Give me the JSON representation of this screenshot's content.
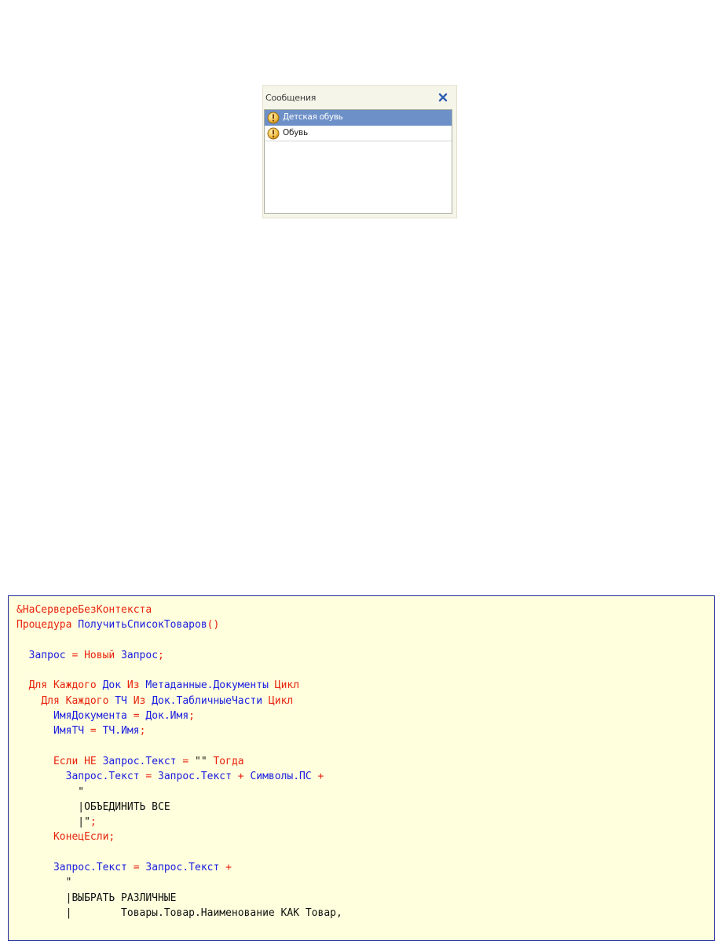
{
  "messages_panel": {
    "title": "Сообщения",
    "close_icon": "close-x-icon",
    "items": [
      {
        "text": "Детская обувь",
        "icon": "warning-icon",
        "selected": true
      },
      {
        "text": "Обувь",
        "icon": "warning-icon",
        "selected": false
      }
    ]
  },
  "code": {
    "lines": [
      [
        {
          "t": "&НаСервереБезКонтекста",
          "c": "kw"
        }
      ],
      [
        {
          "t": "Процедура ",
          "c": "kw"
        },
        {
          "t": "ПолучитьСписокТоваров",
          "c": "id"
        },
        {
          "t": "()",
          "c": "kw"
        }
      ],
      [],
      [
        {
          "t": "  ",
          "c": "pl"
        },
        {
          "t": "Запрос",
          "c": "id"
        },
        {
          "t": " = ",
          "c": "kw"
        },
        {
          "t": "Новый ",
          "c": "kw"
        },
        {
          "t": "Запрос",
          "c": "id"
        },
        {
          "t": ";",
          "c": "kw"
        }
      ],
      [],
      [
        {
          "t": "  ",
          "c": "pl"
        },
        {
          "t": "Для Каждого ",
          "c": "kw"
        },
        {
          "t": "Док",
          "c": "id"
        },
        {
          "t": " Из ",
          "c": "kw"
        },
        {
          "t": "Метаданные.Документы",
          "c": "id"
        },
        {
          "t": " Цикл",
          "c": "kw"
        }
      ],
      [
        {
          "t": "    ",
          "c": "pl"
        },
        {
          "t": "Для Каждого ",
          "c": "kw"
        },
        {
          "t": "ТЧ",
          "c": "id"
        },
        {
          "t": " Из ",
          "c": "kw"
        },
        {
          "t": "Док.ТабличныеЧасти",
          "c": "id"
        },
        {
          "t": " Цикл",
          "c": "kw"
        }
      ],
      [
        {
          "t": "      ",
          "c": "pl"
        },
        {
          "t": "ИмяДокумента",
          "c": "id"
        },
        {
          "t": " = ",
          "c": "kw"
        },
        {
          "t": "Док.Имя",
          "c": "id"
        },
        {
          "t": ";",
          "c": "kw"
        }
      ],
      [
        {
          "t": "      ",
          "c": "pl"
        },
        {
          "t": "ИмяТЧ",
          "c": "id"
        },
        {
          "t": " = ",
          "c": "kw"
        },
        {
          "t": "ТЧ.Имя",
          "c": "id"
        },
        {
          "t": ";",
          "c": "kw"
        }
      ],
      [],
      [
        {
          "t": "      ",
          "c": "pl"
        },
        {
          "t": "Если НЕ ",
          "c": "kw"
        },
        {
          "t": "Запрос.Текст",
          "c": "id"
        },
        {
          "t": " = ",
          "c": "kw"
        },
        {
          "t": "\"\"",
          "c": "str"
        },
        {
          "t": " Тогда",
          "c": "kw"
        }
      ],
      [
        {
          "t": "        ",
          "c": "pl"
        },
        {
          "t": "Запрос.Текст",
          "c": "id"
        },
        {
          "t": " = ",
          "c": "kw"
        },
        {
          "t": "Запрос.Текст",
          "c": "id"
        },
        {
          "t": " + ",
          "c": "kw"
        },
        {
          "t": "Символы.ПС",
          "c": "id"
        },
        {
          "t": " +",
          "c": "kw"
        }
      ],
      [
        {
          "t": "          \"",
          "c": "str"
        }
      ],
      [
        {
          "t": "          |ОБЪЕДИНИТЬ ВСЕ",
          "c": "str"
        }
      ],
      [
        {
          "t": "          |\"",
          "c": "str"
        },
        {
          "t": ";",
          "c": "kw"
        }
      ],
      [
        {
          "t": "      ",
          "c": "pl"
        },
        {
          "t": "КонецЕсли;",
          "c": "kw"
        }
      ],
      [],
      [
        {
          "t": "      ",
          "c": "pl"
        },
        {
          "t": "Запрос.Текст",
          "c": "id"
        },
        {
          "t": " = ",
          "c": "kw"
        },
        {
          "t": "Запрос.Текст",
          "c": "id"
        },
        {
          "t": " +",
          "c": "kw"
        }
      ],
      [
        {
          "t": "        \"",
          "c": "str"
        }
      ],
      [
        {
          "t": "        |ВЫБРАТЬ РАЗЛИЧНЫЕ",
          "c": "str"
        }
      ],
      [
        {
          "t": "        |        Товары.Товар.Наименование КАК Товар,",
          "c": "str"
        }
      ]
    ]
  },
  "colors": {
    "keyword": "#e8230f",
    "identifier": "#1a1de0",
    "string": "#111111",
    "code_background": "#ffffdd",
    "code_border": "#1e2a9a",
    "selection": "#6d90c8"
  }
}
